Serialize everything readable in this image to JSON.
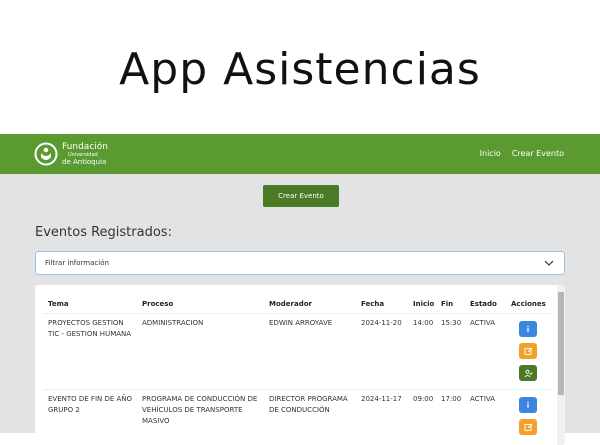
{
  "app_title": "App Asistencias",
  "nav": {
    "logo": {
      "line1": "Fundación",
      "line2": "Universidad",
      "line3": "de Antioquia"
    },
    "links": [
      "Inicio",
      "Crear Evento"
    ]
  },
  "create_event_button": "Crear Evento",
  "section_title": "Eventos Registrados:",
  "filter": {
    "placeholder": "Filtrar información"
  },
  "table": {
    "headers": [
      "Tema",
      "Proceso",
      "Moderador",
      "Fecha",
      "Inicio",
      "Fin",
      "Estado",
      "Acciones"
    ],
    "rows": [
      {
        "tema": [
          "PROYECTOS GESTION",
          "TIC - GESTION HUMANA"
        ],
        "proceso": [
          "ADMINISTRACION"
        ],
        "moderador": [
          "EDWIN ARROYAVE"
        ],
        "fecha": "2024-11-20",
        "inicio": "14:00",
        "fin": "15:30",
        "estado": "ACTIVA"
      },
      {
        "tema": [
          "EVENTO DE FIN DE AÑO",
          "GRUPO 2"
        ],
        "proceso": [
          "PROGRAMA DE CONDUCCIÓN DE",
          "VEHÍCULOS DE TRANSPORTE",
          "MASIVO"
        ],
        "moderador": [
          "DIRECTOR PROGRAMA",
          "DE CONDUCCIÓN"
        ],
        "fecha": "2024-11-17",
        "inicio": "09:00",
        "fin": "17:00",
        "estado": "ACTIVA"
      }
    ]
  },
  "colors": {
    "navbar": "#5a9a30",
    "primary_button": "#4a7a26",
    "info": "#3b87e0",
    "edit": "#f2a12a"
  },
  "icons": {
    "info": "info-icon",
    "edit": "edit-icon",
    "attendees": "user-check-icon",
    "filter": "chevron-down-icon"
  }
}
